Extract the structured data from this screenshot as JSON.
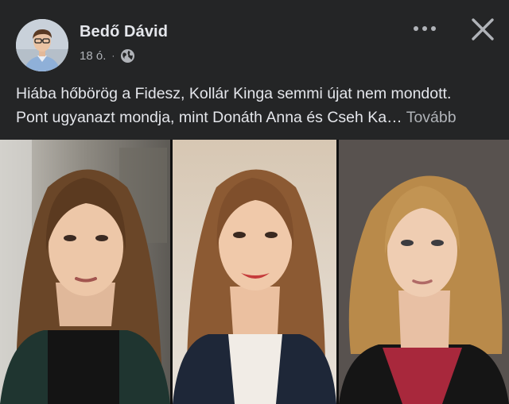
{
  "post": {
    "author": {
      "name": "Bedő Dávid",
      "avatar_icon": "profile-photo"
    },
    "meta": {
      "time": "18 ó.",
      "separator": "·",
      "audience_icon": "globe-icon"
    },
    "actions": {
      "more_icon": "more-dots-icon",
      "close_icon": "close-icon"
    },
    "text": {
      "line1": "Hiába hőbörög a Fidesz, Kollár Kinga semmi újat nem mondott.",
      "line2": "Pont ugyanazt mondja, mint Donáth Anna és Cseh Ka…",
      "see_more": "Tovább"
    },
    "image": {
      "panels": [
        "portrait-woman-1",
        "portrait-woman-2",
        "portrait-woman-3"
      ]
    }
  },
  "colors": {
    "background": "#242526",
    "primary_text": "#e4e6eb",
    "secondary_text": "#b0b3b8"
  }
}
